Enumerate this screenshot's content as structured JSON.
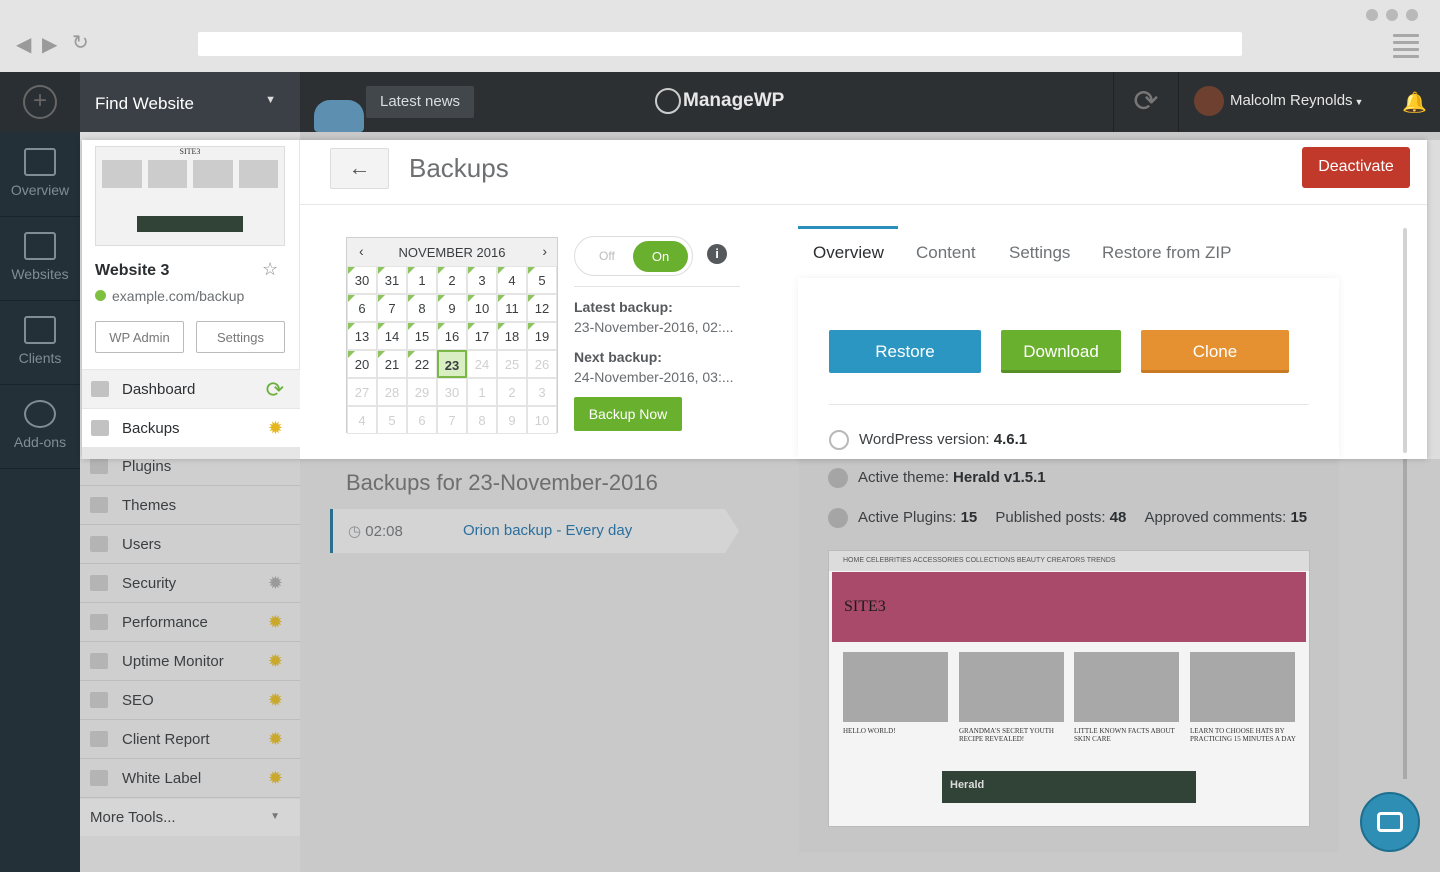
{
  "app": {
    "logo": "ManageWP"
  },
  "header": {
    "find_website": "Find Website",
    "latest_news": "Latest news",
    "user_name": "Malcolm Reynolds"
  },
  "leftnav": [
    {
      "label": "Overview",
      "icon": "chart-icon"
    },
    {
      "label": "Websites",
      "icon": "websites-icon"
    },
    {
      "label": "Clients",
      "icon": "clients-icon"
    },
    {
      "label": "Add-ons",
      "icon": "addons-icon"
    }
  ],
  "site": {
    "name": "Website 3",
    "url": "example.com/backup",
    "wp_admin": "WP Admin",
    "settings": "Settings",
    "thumb_title": "SITE3"
  },
  "sidebar": {
    "items": [
      "Dashboard",
      "Backups",
      "Plugins",
      "Themes",
      "Users",
      "Security",
      "Performance",
      "Uptime Monitor",
      "SEO",
      "Client Report",
      "White Label"
    ],
    "more_tools": "More Tools..."
  },
  "panel": {
    "back": "←",
    "title": "Backups",
    "deactivate": "Deactivate"
  },
  "calendar": {
    "month": "NOVEMBER 2016",
    "prev": "‹",
    "next": "›",
    "weeks": [
      [
        "30",
        "31",
        "1",
        "2",
        "3",
        "4",
        "5"
      ],
      [
        "6",
        "7",
        "8",
        "9",
        "10",
        "11",
        "12"
      ],
      [
        "13",
        "14",
        "15",
        "16",
        "17",
        "18",
        "19"
      ],
      [
        "20",
        "21",
        "22",
        "23",
        "24",
        "25",
        "26"
      ],
      [
        "27",
        "28",
        "29",
        "30",
        "1",
        "2",
        "3"
      ],
      [
        "4",
        "5",
        "6",
        "7",
        "8",
        "9",
        "10"
      ]
    ],
    "selected": "23"
  },
  "toggle": {
    "off": "Off",
    "on": "On",
    "info": "i"
  },
  "backup_info": {
    "latest_label": "Latest backup:",
    "latest_value": "23-November-2016, 02:...",
    "next_label": "Next backup:",
    "next_value": "24-November-2016, 03:...",
    "backup_now": "Backup Now"
  },
  "tabs": [
    "Overview",
    "Content",
    "Settings",
    "Restore from ZIP"
  ],
  "actions": {
    "restore": "Restore",
    "download": "Download",
    "clone": "Clone"
  },
  "overview_info": {
    "wp_version_label": "WordPress version:",
    "wp_version": "4.6.1",
    "theme_label": "Active theme:",
    "theme": "Herald v1.5.1",
    "plugins_label": "Active Plugins:",
    "plugins": "15",
    "posts_label": "Published posts:",
    "posts": "48",
    "comments_label": "Approved comments:",
    "comments": "15"
  },
  "backups_list": {
    "heading": "Backups for 23-November-2016",
    "time": "02:08",
    "name": "Orion backup - Every day"
  },
  "preview": {
    "nav": "HOME   CELEBRITIES   ACCESSORIES   COLLECTIONS   BEAUTY   CREATORS   TRENDS",
    "hero": "SITE3",
    "captions": [
      "HELLO WORLD!",
      "GRANDMA'S SECRET YOUTH RECIPE REVEALED!",
      "LITTLE KNOWN FACTS ABOUT SKIN CARE",
      "LEARN TO CHOOSE HATS BY PRACTICING 15 MINUTES A DAY"
    ],
    "banner": "Herald"
  },
  "colors": {
    "accent": "#6ab02f",
    "danger": "#c0392b",
    "info": "#2b96c2",
    "warning": "#e59131"
  }
}
